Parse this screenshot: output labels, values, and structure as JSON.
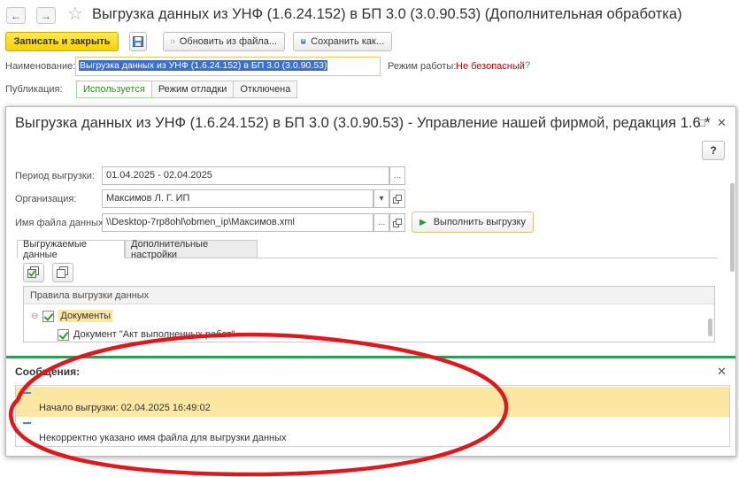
{
  "outer": {
    "title": "Выгрузка данных из УНФ (1.6.24.152) в БП 3.0 (3.0.90.53) (Дополнительная обработка)",
    "toolbar": {
      "save_close": "Записать и закрыть",
      "update_from_file": "Обновить из файла...",
      "save_as": "Сохранить как..."
    },
    "name_label": "Наименование:",
    "name_value": "Выгрузка данных из УНФ (1.6.24.152) в БП 3.0 (3.0.90.53)",
    "mode_label": "Режим работы:",
    "mode_value": "Не безопасный",
    "mode_help": "?",
    "publication_label": "Публикация:",
    "publication_options": [
      "Используется",
      "Режим отладки",
      "Отключена"
    ]
  },
  "modal": {
    "title": "Выгрузка данных из УНФ (1.6.24.152) в БП 3.0 (3.0.90.53) - Управление нашей фирмой, редакция 1.6 *",
    "help": "?",
    "period_label": "Период выгрузки:",
    "period_value": "01.04.2025 - 02.04.2025",
    "org_label": "Организация:",
    "org_value": "Максимов Л. Г. ИП",
    "file_label": "Имя файла данных:",
    "file_value": "\\\\Desktop-7rp8ohl\\obmen_ip\\Максимов.xml",
    "ellipsis": "...",
    "run_button": "Выполнить выгрузку",
    "tabs": [
      "Выгружаемые данные",
      "Дополнительные настройки"
    ],
    "rules_header": "Правила выгрузки данных",
    "tree": {
      "group": "Документы",
      "item": "Документ \"Акт выполненных работ\""
    }
  },
  "messages": {
    "title": "Сообщения:",
    "items": [
      "Начало выгрузки: 02.04.2025 16:49:02",
      "Некорректно указано имя файла для выгрузки данных"
    ]
  },
  "colors": {
    "primary_button": "#f6d200",
    "accent_green": "#2e9a5b",
    "selection_blue": "#3a6fd0",
    "message_highlight": "#fbe7a1",
    "annotation_red": "#e0181b",
    "warning_red": "#c00000"
  }
}
